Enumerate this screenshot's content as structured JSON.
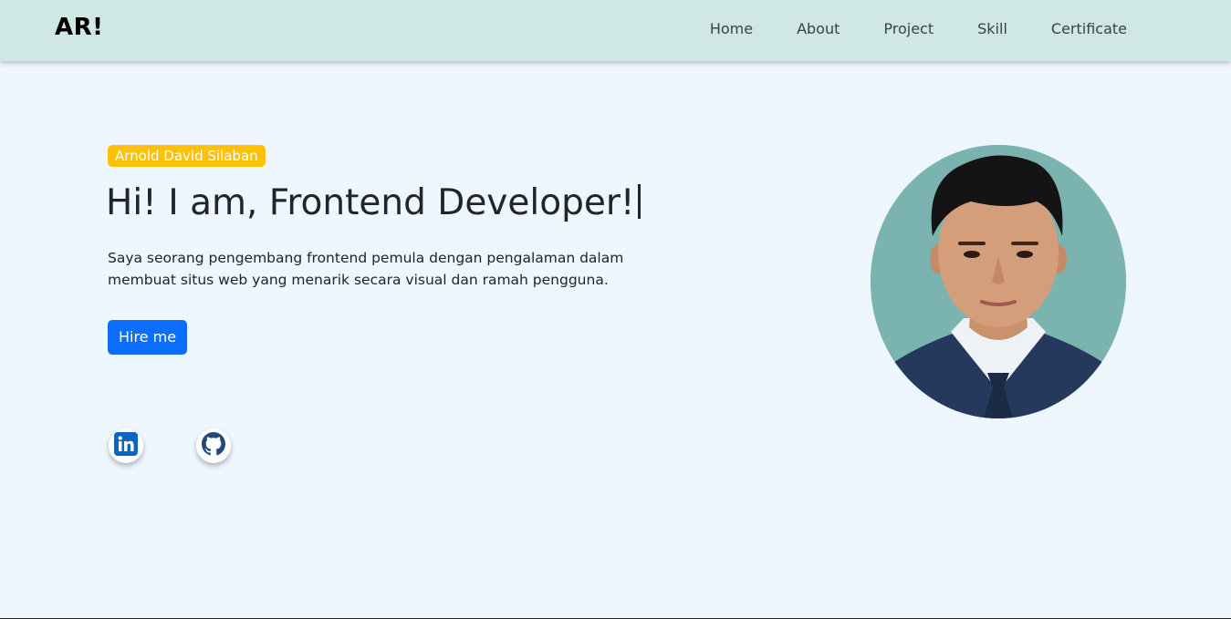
{
  "brand": "AR!",
  "nav": [
    {
      "label": "Home"
    },
    {
      "label": "About"
    },
    {
      "label": "Project"
    },
    {
      "label": "Skill"
    },
    {
      "label": "Certificate"
    }
  ],
  "hero": {
    "name_badge": "Arnold David Silaban",
    "headline": "Hi! I am, Frontend Developer!",
    "description": "Saya seorang pengembang frontend pemula dengan pengalaman dalam membuat situs web yang menarik secara visual dan ramah pengguna.",
    "cta_label": "Hire me"
  },
  "socials": [
    {
      "icon": "linkedin-icon"
    },
    {
      "icon": "github-icon"
    }
  ],
  "colors": {
    "navbar_bg": "#cfe8e4",
    "page_bg": "#eef6fe",
    "badge_bg": "#ffc107",
    "button_bg": "#0d6efd",
    "linkedin": "#0a66c2",
    "photo_bg": "#7ab3b0"
  }
}
